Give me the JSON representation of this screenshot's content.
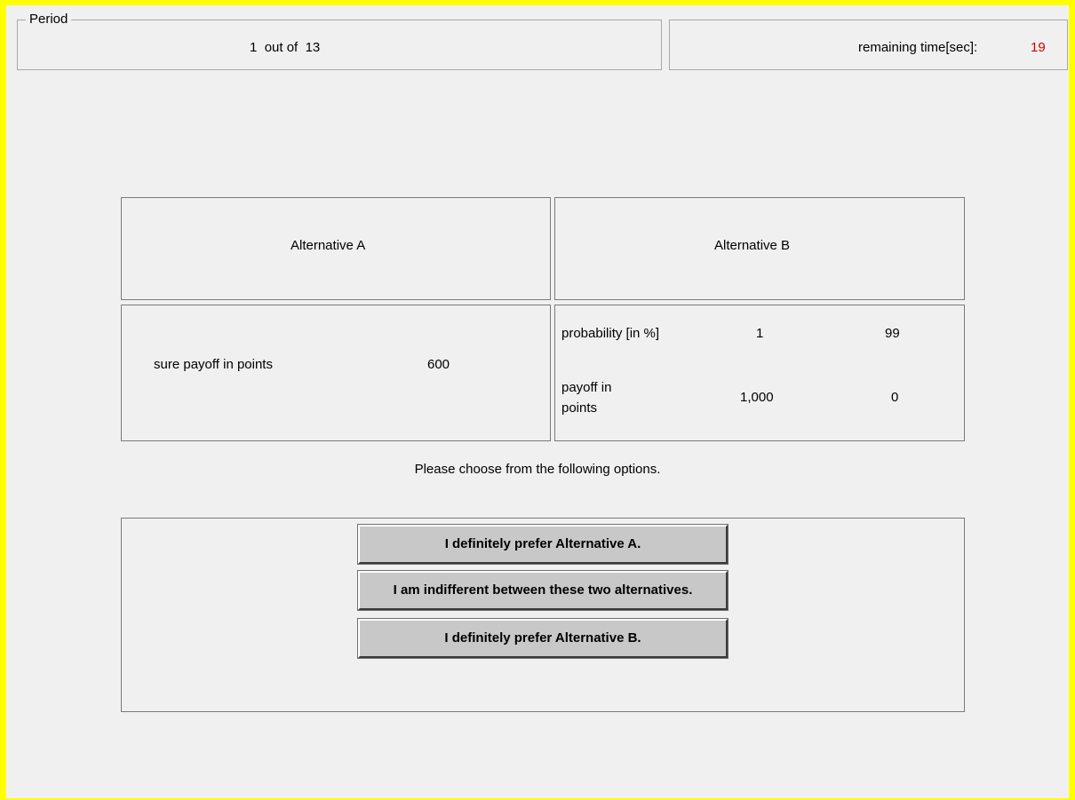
{
  "header": {
    "period_legend": "Period",
    "period_current": "1",
    "period_sep": "out of",
    "period_total": "13",
    "time_label": "remaining time[sec]:",
    "time_value": "19",
    "time_value_color": "#cc0000"
  },
  "alternatives": {
    "a": {
      "title": "Alternative A",
      "sure_label": "sure payoff in points",
      "sure_value": "600"
    },
    "b": {
      "title": "Alternative B",
      "probability_label": "probability [in %]",
      "probabilities": [
        "1",
        "99"
      ],
      "payoff_label_line1": "payoff in",
      "payoff_label_line2": "points",
      "payoffs": [
        "1,000",
        "0"
      ]
    }
  },
  "instruction": "Please choose from the following options.",
  "options": [
    "I definitely prefer Alternative A.",
    "I am indifferent between these two alternatives.",
    "I definitely prefer Alternative B."
  ],
  "colors": {
    "frame": "#ffff00",
    "background": "#f0f0f0",
    "button": "#c8c8c8"
  }
}
